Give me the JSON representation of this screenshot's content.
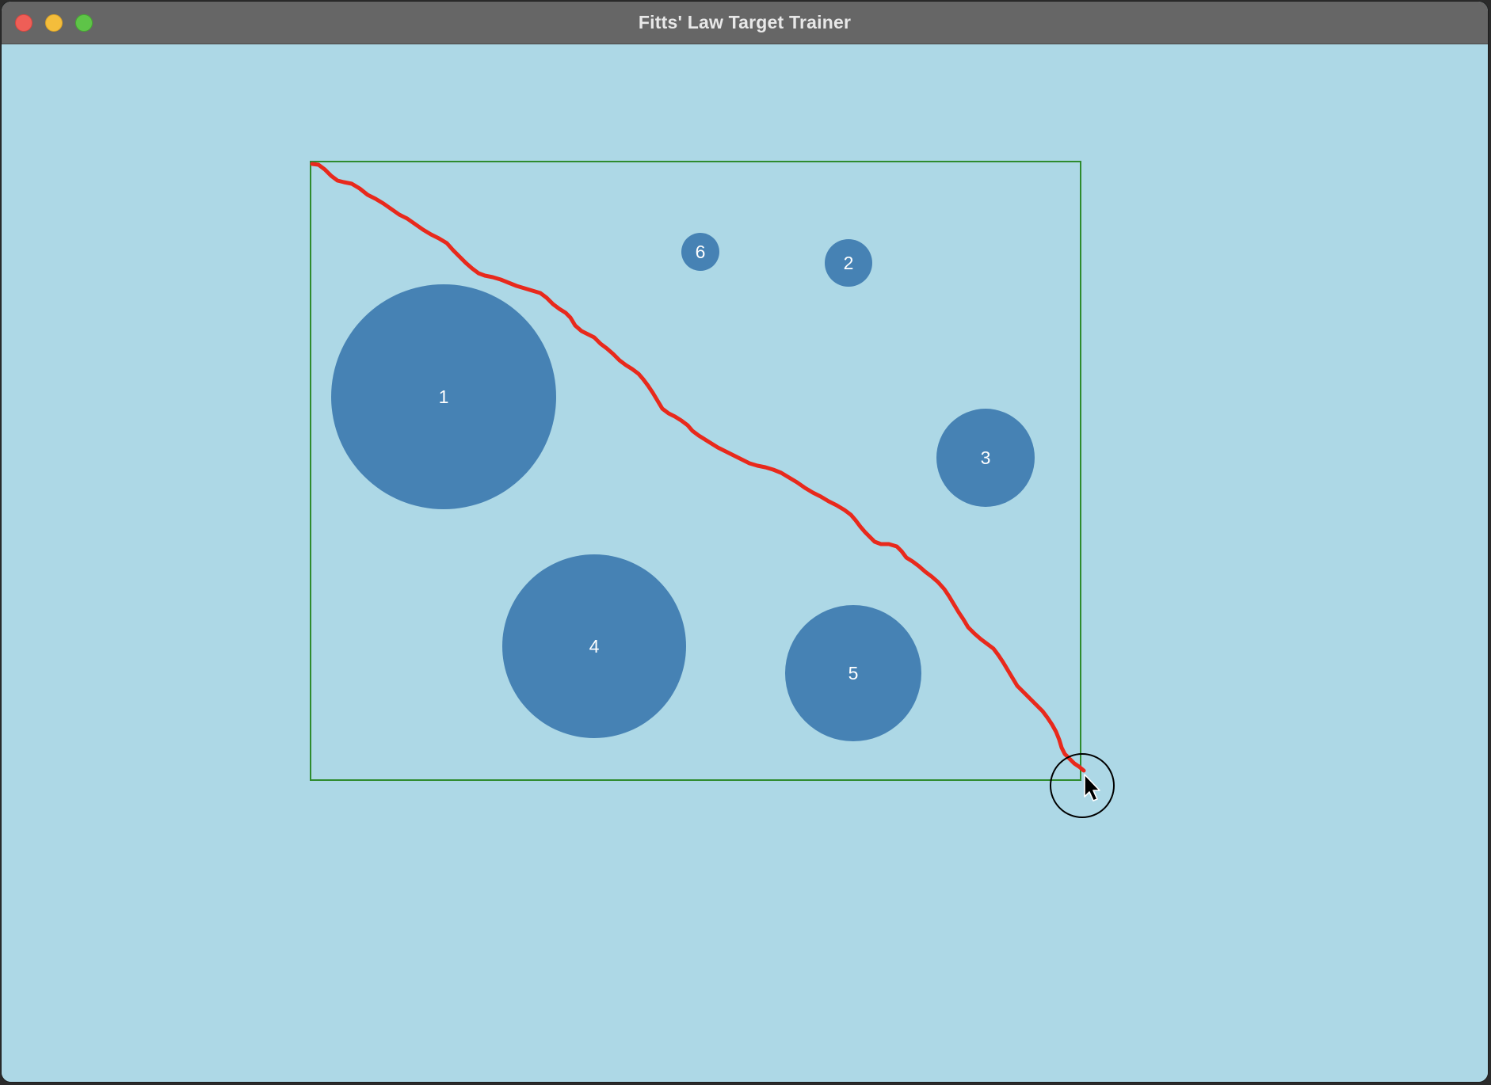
{
  "window": {
    "title": "Fitts' Law Target Trainer",
    "controls": [
      "close",
      "minimize",
      "maximize"
    ]
  },
  "colors": {
    "background": "#add8e6",
    "target_fill": "#4682b4",
    "target_label": "#ffffff",
    "trial_area_border": "#2e8b2e",
    "mouse_trail": "#e8291c",
    "cursor_ring": "#000000"
  },
  "targets": [
    {
      "label": "1"
    },
    {
      "label": "2"
    },
    {
      "label": "3"
    },
    {
      "label": "4"
    },
    {
      "label": "5"
    },
    {
      "label": "6"
    }
  ],
  "cursor": {
    "icon": "arrow-pointer-icon"
  }
}
